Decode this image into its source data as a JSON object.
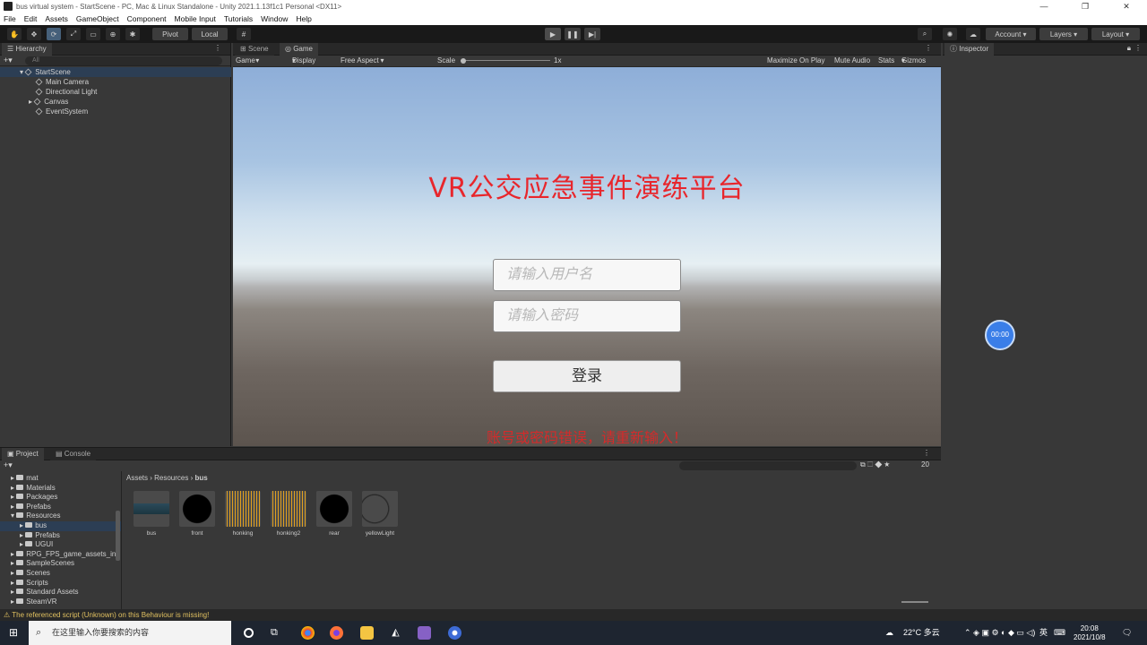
{
  "window": {
    "title": "bus virtual system - StartScene - PC, Mac & Linux Standalone - Unity 2021.1.13f1c1 Personal <DX11>",
    "controls": [
      "—",
      "❐",
      "✕"
    ]
  },
  "menu": [
    "File",
    "Edit",
    "Assets",
    "GameObject",
    "Component",
    "Mobile Input",
    "Tutorials",
    "Window",
    "Help"
  ],
  "toolbar": {
    "pivot_label": "Pivot",
    "local_label": "Local",
    "account_label": "Account",
    "layers_label": "Layers",
    "layout_label": "Layout"
  },
  "hierarchy": {
    "tab_label": "Hierarchy",
    "search_placeholder": "All",
    "scene_name": "StartScene",
    "objects": [
      "Main Camera",
      "Directional Light",
      "Canvas",
      "EventSystem"
    ]
  },
  "game_panel": {
    "tabs": [
      "Scene",
      "Game"
    ],
    "toolbar": {
      "mode": "Game",
      "display": "Display 1",
      "aspect": "Free Aspect",
      "scale_label": "Scale",
      "scale_value": "1x",
      "maximize": "Maximize On Play",
      "mute": "Mute Audio",
      "stats": "Stats",
      "gizmos": "Gizmos"
    },
    "title": "VR公交应急事件演练平台",
    "username_placeholder": "请输入用户名",
    "password_placeholder": "请输入密码",
    "login_label": "登录",
    "error_message": "账号或密码错误，请重新输入！"
  },
  "inspector": {
    "tab_label": "Inspector",
    "timer": "00:00"
  },
  "project": {
    "tabs": [
      "Project",
      "Console"
    ],
    "tree": [
      {
        "name": "mat",
        "level": 1
      },
      {
        "name": "Materials",
        "level": 1
      },
      {
        "name": "Packages",
        "level": 1
      },
      {
        "name": "Prefabs",
        "level": 1
      },
      {
        "name": "Resources",
        "level": 1
      },
      {
        "name": "bus",
        "level": 2
      },
      {
        "name": "Prefabs",
        "level": 2
      },
      {
        "name": "UGUI",
        "level": 2
      },
      {
        "name": "RPG_FPS_game_assets_in",
        "level": 1
      },
      {
        "name": "SampleScenes",
        "level": 1
      },
      {
        "name": "Scenes",
        "level": 1
      },
      {
        "name": "Scripts",
        "level": 1
      },
      {
        "name": "Standard Assets",
        "level": 1
      },
      {
        "name": "SteamVR",
        "level": 1
      }
    ],
    "breadcrumb": [
      "Assets",
      "Resources",
      "bus"
    ],
    "hidden_count": "20",
    "assets": [
      "bus",
      "front",
      "honking",
      "honking2",
      "rear",
      "yellowLight"
    ]
  },
  "status": {
    "message": "⚠ The referenced script (Unknown) on this Behaviour is missing!"
  },
  "taskbar": {
    "search_placeholder": "在这里输入你要搜索的内容",
    "weather": "22°C  多云",
    "ime": "英",
    "time": "20:08",
    "date": "2021/10/8"
  }
}
